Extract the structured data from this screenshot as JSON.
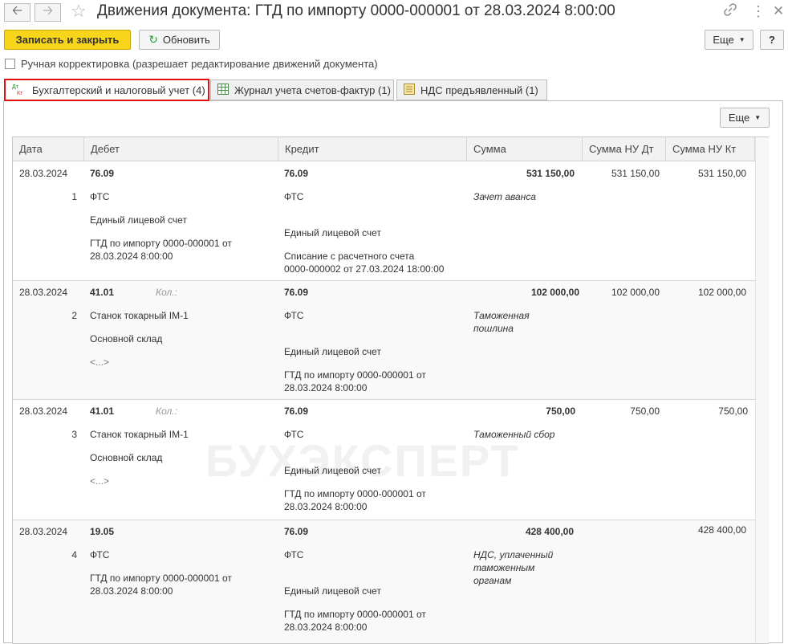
{
  "window": {
    "title": "Движения документа: ГТД по импорту 0000-000001 от 28.03.2024 8:00:00",
    "back_icon": "arrow-left-icon",
    "forward_icon": "arrow-right-icon",
    "favorite_icon": "star-icon",
    "link_icon": "link-icon",
    "more_icon": "vertical-dots-icon",
    "close_icon": "close-icon"
  },
  "toolbar": {
    "save_close_label": "Записать и закрыть",
    "refresh_label": "Обновить",
    "more_label": "Еще",
    "help_label": "?"
  },
  "manual_edit": {
    "label": "Ручная корректировка (разрешает редактирование движений документа)",
    "checked": false
  },
  "tabs": [
    {
      "label": "Бухгалтерский и налоговый учет (4)",
      "icon": "dt-kt-icon",
      "active": true
    },
    {
      "label": "Журнал учета счетов-фактур (1)",
      "icon": "table-icon",
      "active": false
    },
    {
      "label": "НДС предъявленный (1)",
      "icon": "register-icon",
      "active": false
    }
  ],
  "panel": {
    "more_label": "Еще"
  },
  "watermark": "БУХЭКСПЕРТ",
  "columns": [
    "Дата",
    "Дебет",
    "Кредит",
    "Сумма",
    "Сумма НУ Дт",
    "Сумма НУ Кт"
  ],
  "rows": [
    {
      "date": "28.03.2024",
      "num": "1",
      "debit_account": "76.09",
      "debit_qty_label": "",
      "debit_sub1": "ФТС",
      "debit_sub2": "Единый лицевой счет",
      "debit_sub3_line1": "ГТД по импорту 0000-000001 от",
      "debit_sub3_line2": "28.03.2024 8:00:00",
      "credit_account": "76.09",
      "credit_sub1": "ФТС",
      "credit_sub2": "Единый лицевой счет",
      "credit_sub3_line1": "Списание с расчетного счета",
      "credit_sub3_line2": "0000-000002 от 27.03.2024 18:00:00",
      "amount": "531 150,00",
      "content_line1": "Зачет аванса",
      "content_line2": "",
      "content_line3": "",
      "amount_nu_dt": "531 150,00",
      "amount_nu_kt": "531 150,00"
    },
    {
      "date": "28.03.2024",
      "num": "2",
      "debit_account": "41.01",
      "debit_qty_label": "Кол.:",
      "debit_sub1": "Станок токарный IM-1",
      "debit_sub2": "Основной склад",
      "debit_sub3_line1": "<...>",
      "debit_sub3_line2": "",
      "credit_account": "76.09",
      "credit_sub1": "ФТС",
      "credit_sub2": "Единый лицевой счет",
      "credit_sub3_line1": "ГТД по импорту 0000-000001 от",
      "credit_sub3_line2": "28.03.2024 8:00:00",
      "amount": "102 000,00",
      "content_line1": "Таможенная",
      "content_line2": "пошлина",
      "content_line3": "",
      "amount_nu_dt": "102 000,00",
      "amount_nu_kt": "102 000,00"
    },
    {
      "date": "28.03.2024",
      "num": "3",
      "debit_account": "41.01",
      "debit_qty_label": "Кол.:",
      "debit_sub1": "Станок токарный IM-1",
      "debit_sub2": "Основной склад",
      "debit_sub3_line1": "<...>",
      "debit_sub3_line2": "",
      "credit_account": "76.09",
      "credit_sub1": "ФТС",
      "credit_sub2": "Единый лицевой счет",
      "credit_sub3_line1": "ГТД по импорту 0000-000001 от",
      "credit_sub3_line2": "28.03.2024 8:00:00",
      "amount": "750,00",
      "content_line1": "Таможенный сбор",
      "content_line2": "",
      "content_line3": "",
      "amount_nu_dt": "750,00",
      "amount_nu_kt": "750,00"
    },
    {
      "date": "28.03.2024",
      "num": "4",
      "debit_account": "19.05",
      "debit_qty_label": "",
      "debit_sub1": "ФТС",
      "debit_sub2": "ГТД по импорту 0000-000001 от",
      "debit_sub3_line1": "28.03.2024 8:00:00",
      "debit_sub3_line2": "",
      "credit_account": "76.09",
      "credit_sub1": "ФТС",
      "credit_sub2": "Единый лицевой счет",
      "credit_sub3_line1": "ГТД по импорту 0000-000001 от",
      "credit_sub3_line2": "28.03.2024 8:00:00",
      "amount": "428 400,00",
      "content_line1": "НДС, уплаченный",
      "content_line2": "таможенным",
      "content_line3": "органам",
      "amount_nu_dt": "",
      "amount_nu_kt": "428 400,00"
    }
  ]
}
